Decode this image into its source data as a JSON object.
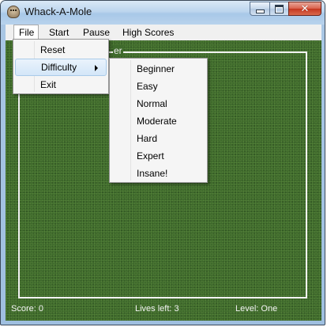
{
  "window": {
    "title": "Whack-A-Mole"
  },
  "menubar": {
    "items": [
      "File",
      "Start",
      "Pause",
      "High Scores"
    ]
  },
  "file_menu": {
    "items": [
      "Reset",
      "Difficulty",
      "Exit"
    ]
  },
  "difficulty_menu": {
    "items": [
      "Beginner",
      "Easy",
      "Normal",
      "Moderate",
      "Hard",
      "Expert",
      "Insane!"
    ]
  },
  "field": {
    "label_fragment": "er"
  },
  "status": {
    "score": "Score: 0",
    "lives": "Lives left: 3",
    "level": "Level: One"
  },
  "icons": {
    "app": "mole-icon",
    "minimize": "minimize-icon",
    "maximize": "maximize-icon",
    "close": "close-icon",
    "submenu": "submenu-arrow-icon"
  },
  "colors": {
    "field_green": "#3f6a2c",
    "menu_highlight": "#d3e6f8"
  }
}
